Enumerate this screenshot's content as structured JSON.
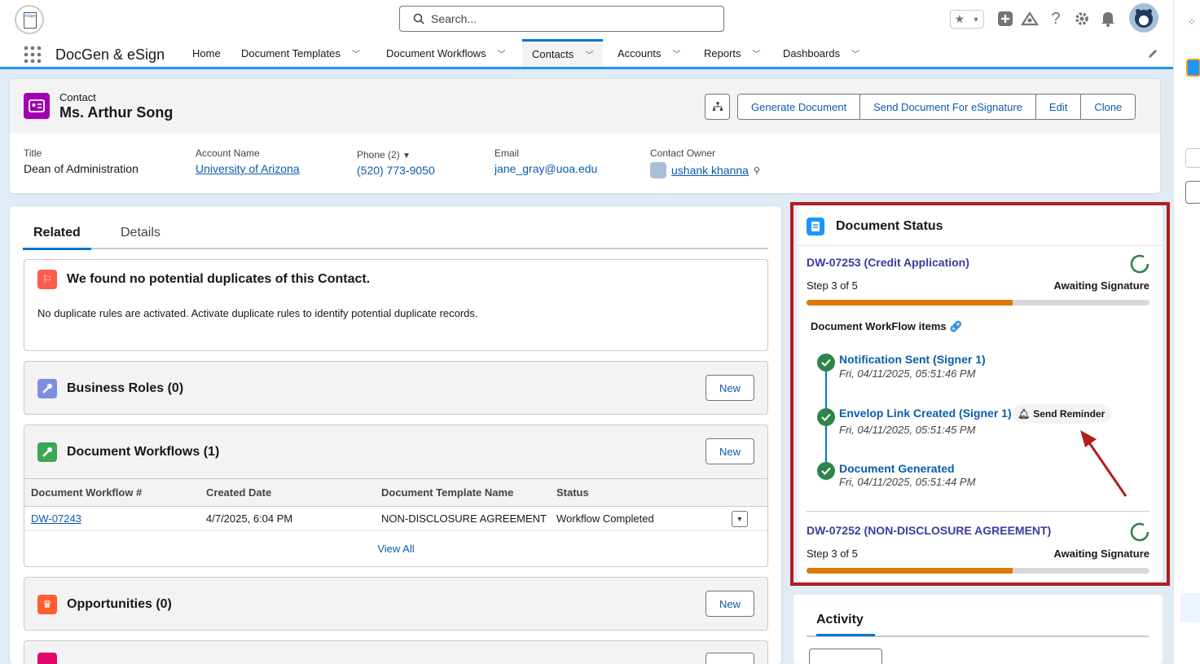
{
  "header": {
    "search_placeholder": "Search...",
    "icons": [
      "star-favorites-icon",
      "add-icon",
      "trailhead-icon",
      "help-icon",
      "setup-gear-icon",
      "notifications-bell-icon",
      "user-avatar-icon"
    ]
  },
  "nav": {
    "app_name": "DocGen & eSign",
    "items": [
      {
        "label": "Home"
      },
      {
        "label": "Document Templates"
      },
      {
        "label": "Document Workflows"
      },
      {
        "label": "Contacts"
      },
      {
        "label": "Accounts"
      },
      {
        "label": "Reports"
      },
      {
        "label": "Dashboards"
      }
    ],
    "active": "Contacts"
  },
  "record": {
    "type": "Contact",
    "name": "Ms. Arthur Song",
    "actions": [
      "Generate Document",
      "Send Document For eSignature",
      "Edit",
      "Clone"
    ],
    "fields": {
      "title_label": "Title",
      "title": "Dean of Administration",
      "account_label": "Account Name",
      "account": "University of Arizona",
      "phone_label": "Phone (2)",
      "phone": "(520) 773-9050",
      "email_label": "Email",
      "email": "jane_gray@uoa.edu",
      "owner_label": "Contact Owner",
      "owner": "ushank khanna"
    }
  },
  "tabs": {
    "related": "Related",
    "details": "Details"
  },
  "duplicates": {
    "title": "We found no potential duplicates of this Contact.",
    "text": "No duplicate rules are activated. Activate duplicate rules to identify potential duplicate records."
  },
  "business_roles": {
    "title": "Business Roles (0)",
    "new": "New"
  },
  "document_workflows": {
    "title": "Document Workflows (1)",
    "new": "New",
    "columns": [
      "Document Workflow #",
      "Created Date",
      "Document Template Name",
      "Status"
    ],
    "rows": [
      {
        "id": "DW-07243",
        "created": "4/7/2025, 6:04 PM",
        "template": "NON-DISCLOSURE AGREEMENT",
        "status": "Workflow Completed"
      }
    ],
    "view_all": "View All"
  },
  "opportunities": {
    "title": "Opportunities (0)",
    "new": "New"
  },
  "document_status": {
    "title": "Document Status",
    "workflows": [
      {
        "name": "DW-07253 (Credit Application)",
        "step": "Step 3 of 5",
        "status": "Awaiting Signature",
        "progress": 0.6
      },
      {
        "name": "DW-07252 (NON-DISCLOSURE AGREEMENT)",
        "step": "Step 3 of 5",
        "status": "Awaiting Signature",
        "progress": 0.6
      }
    ],
    "items_label": "Document WorkFlow items",
    "items": [
      {
        "name": "Notification Sent (Signer 1)",
        "date": "Fri, 04/11/2025, 05:51:46 PM"
      },
      {
        "name": "Envelop Link Created (Signer 1)",
        "date": "Fri, 04/11/2025, 05:51:45 PM"
      },
      {
        "name": "Document Generated",
        "date": "Fri, 04/11/2025, 05:51:44 PM"
      }
    ],
    "send_reminder": "Send Reminder"
  },
  "activity": {
    "title": "Activity"
  },
  "colors": {
    "accent": "#0176d3",
    "highlight_box": "#b01e1e",
    "progress": "#dd7a01",
    "success": "#2e844a"
  }
}
